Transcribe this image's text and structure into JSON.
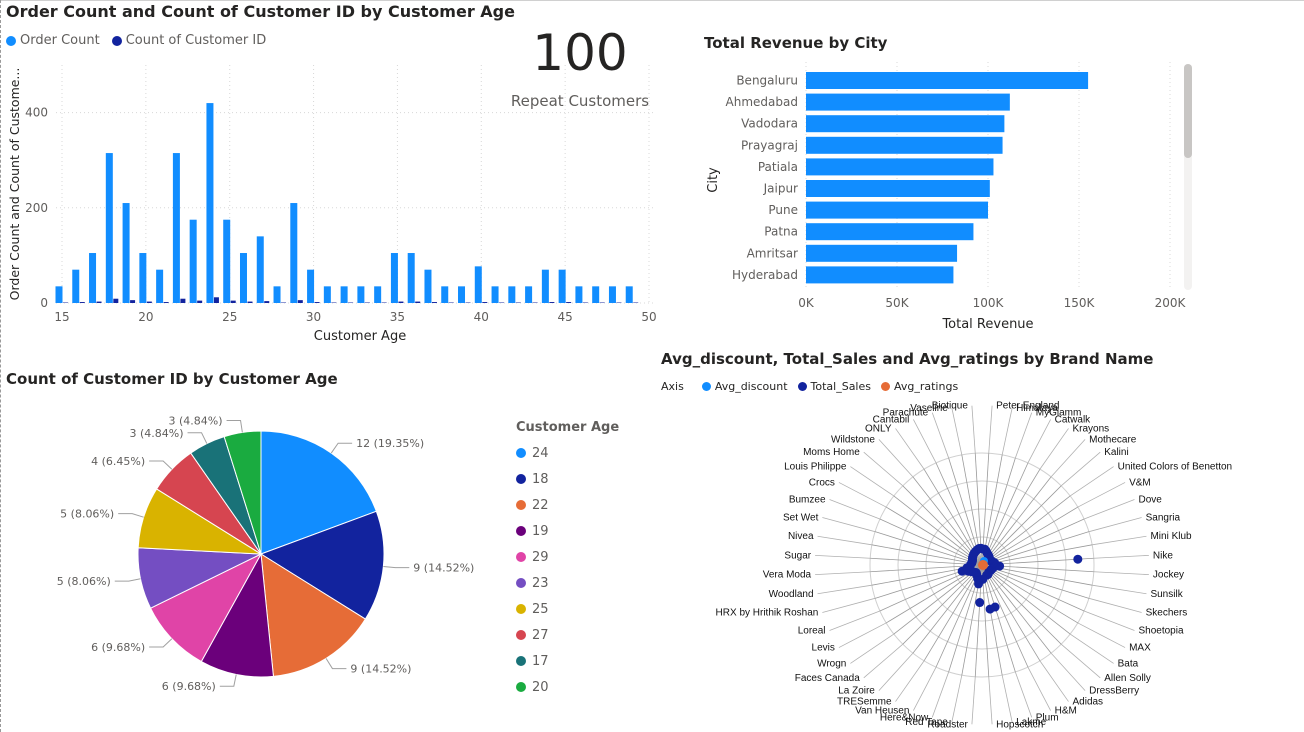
{
  "column_chart": {
    "title": "Order Count and Count of Customer ID by Customer Age",
    "legend": [
      "Order Count",
      "Count of Customer ID"
    ]
  },
  "kpi": {
    "value": "100",
    "label": "Repeat Customers"
  },
  "city_chart": {
    "title": "Total Revenue by City"
  },
  "pie_chart": {
    "title": "Count of Customer ID by Customer Age",
    "legend_title": "Customer Age"
  },
  "radar_chart": {
    "title": "Avg_discount, Total_Sales and Avg_ratings by Brand Name",
    "legend_label": "Axis",
    "legend": [
      "Avg_discount",
      "Total_Sales",
      "Avg_ratings"
    ]
  },
  "chart_data": [
    {
      "type": "bar",
      "title": "Order Count and Count of Customer ID by Customer Age",
      "xlabel": "Customer Age",
      "ylabel": "Order Count and Count of Custome...",
      "x": [
        15,
        16,
        17,
        18,
        19,
        20,
        21,
        22,
        23,
        24,
        25,
        26,
        27,
        28,
        29,
        30,
        31,
        32,
        33,
        34,
        35,
        36,
        37,
        38,
        39,
        40,
        41,
        42,
        43,
        44,
        45,
        46,
        47,
        48,
        49
      ],
      "series": [
        {
          "name": "Order Count",
          "color": "#118DFF",
          "values": [
            35,
            70,
            105,
            315,
            210,
            105,
            70,
            315,
            175,
            420,
            175,
            105,
            140,
            35,
            210,
            70,
            35,
            35,
            35,
            35,
            105,
            105,
            70,
            35,
            35,
            77,
            35,
            35,
            35,
            70,
            70,
            35,
            35,
            35,
            35
          ]
        },
        {
          "name": "Count of Customer ID",
          "color": "#12239E",
          "values": [
            1,
            2,
            3,
            9,
            6,
            3,
            2,
            9,
            5,
            12,
            5,
            3,
            4,
            1,
            6,
            2,
            1,
            1,
            1,
            1,
            3,
            3,
            2,
            1,
            1,
            2,
            1,
            1,
            1,
            2,
            2,
            1,
            1,
            1,
            1
          ]
        }
      ],
      "xticks": [
        15,
        20,
        25,
        30,
        35,
        40,
        45,
        50
      ],
      "yticks": [
        0,
        200,
        400
      ],
      "ylim": [
        0,
        500
      ],
      "grid": true,
      "legend": "top-left"
    },
    {
      "type": "bar",
      "orientation": "horizontal",
      "title": "Total Revenue by City",
      "xlabel": "Total Revenue",
      "ylabel": "City",
      "categories": [
        "Bengaluru",
        "Ahmedabad",
        "Vadodara",
        "Prayagraj",
        "Patiala",
        "Jaipur",
        "Pune",
        "Patna",
        "Amritsar",
        "Hyderabad"
      ],
      "values": [
        155000,
        112000,
        109000,
        108000,
        103000,
        101000,
        100000,
        92000,
        83000,
        81000
      ],
      "xticks": [
        0,
        50000,
        100000,
        150000,
        200000
      ],
      "xtick_labels": [
        "0K",
        "50K",
        "100K",
        "150K",
        "200K"
      ],
      "xlim": [
        0,
        200000
      ],
      "color": "#118DFF"
    },
    {
      "type": "pie",
      "title": "Count of Customer ID by Customer Age",
      "legend_title": "Customer Age",
      "categories": [
        "24",
        "18",
        "22",
        "19",
        "29",
        "23",
        "25",
        "27",
        "17",
        "20"
      ],
      "values": [
        12,
        9,
        9,
        6,
        6,
        5,
        5,
        4,
        3,
        3
      ],
      "labels": [
        "12 (19.35%)",
        "9 (14.52%)",
        "9 (14.52%)",
        "6 (9.68%)",
        "6 (9.68%)",
        "5 (8.06%)",
        "5 (8.06%)",
        "4 (6.45%)",
        "3 (4.84%)",
        "3 (4.84%)"
      ],
      "colors": [
        "#118DFF",
        "#12239E",
        "#E66C37",
        "#6B007B",
        "#E044A7",
        "#744EC2",
        "#D9B300",
        "#D64550",
        "#197278",
        "#1AAB40"
      ],
      "legend": "right"
    },
    {
      "type": "radar",
      "title": "Avg_discount, Total_Sales and Avg_ratings by Brand Name",
      "axes": [
        "Peter England",
        "Himalaya",
        "MyGlamm",
        "Catwalk",
        "Krayons",
        "Mothecare",
        "Kalini",
        "United Colors of Benetton",
        "V&M",
        "Dove",
        "Sangria",
        "Mini Klub",
        "Nike",
        "Jockey",
        "Sunsilk",
        "Skechers",
        "Shoetopia",
        "MAX",
        "Bata",
        "Allen Solly",
        "DressBerry",
        "Adidas",
        "H&M",
        "Plum",
        "Lakme",
        "Hopscotch",
        "Roadster",
        "Red Tape",
        "Here&Now",
        "Van Heusen",
        "TRESemme",
        "La Zoire",
        "Faces Canada",
        "Wrogn",
        "Levis",
        "Loreal",
        "HRX by Hrithik Roshan",
        "Woodland",
        "Vera Moda",
        "Sugar",
        "Nivea",
        "Set Wet",
        "Bumzee",
        "Crocs",
        "Louis Philippe",
        "Moms Home",
        "Wildstone",
        "ONLY",
        "Cantabil",
        "Parachute",
        "Vaseline",
        "Biotique"
      ],
      "series": [
        {
          "name": "Avg_discount",
          "color": "#118DFF"
        },
        {
          "name": "Total_Sales",
          "color": "#12239E",
          "values": [
            2000,
            2000,
            1800,
            1600,
            1500,
            1400,
            1300,
            1200,
            1200,
            1200,
            1400,
            1600,
            12000,
            2200,
            1500,
            1400,
            1300,
            1300,
            1200,
            1200,
            1300,
            1400,
            1400,
            5500,
            5600,
            1800,
            4700,
            2400,
            1800,
            1500,
            1300,
            1200,
            1300,
            1400,
            1600,
            1900,
            2600,
            1900,
            1500,
            1400,
            1300,
            1300,
            1300,
            1400,
            1500,
            1600,
            1700,
            1800,
            1900,
            2000,
            2100,
            2100
          ]
        },
        {
          "name": "Avg_ratings",
          "color": "#E66C37"
        }
      ],
      "legend": "top-left"
    }
  ]
}
